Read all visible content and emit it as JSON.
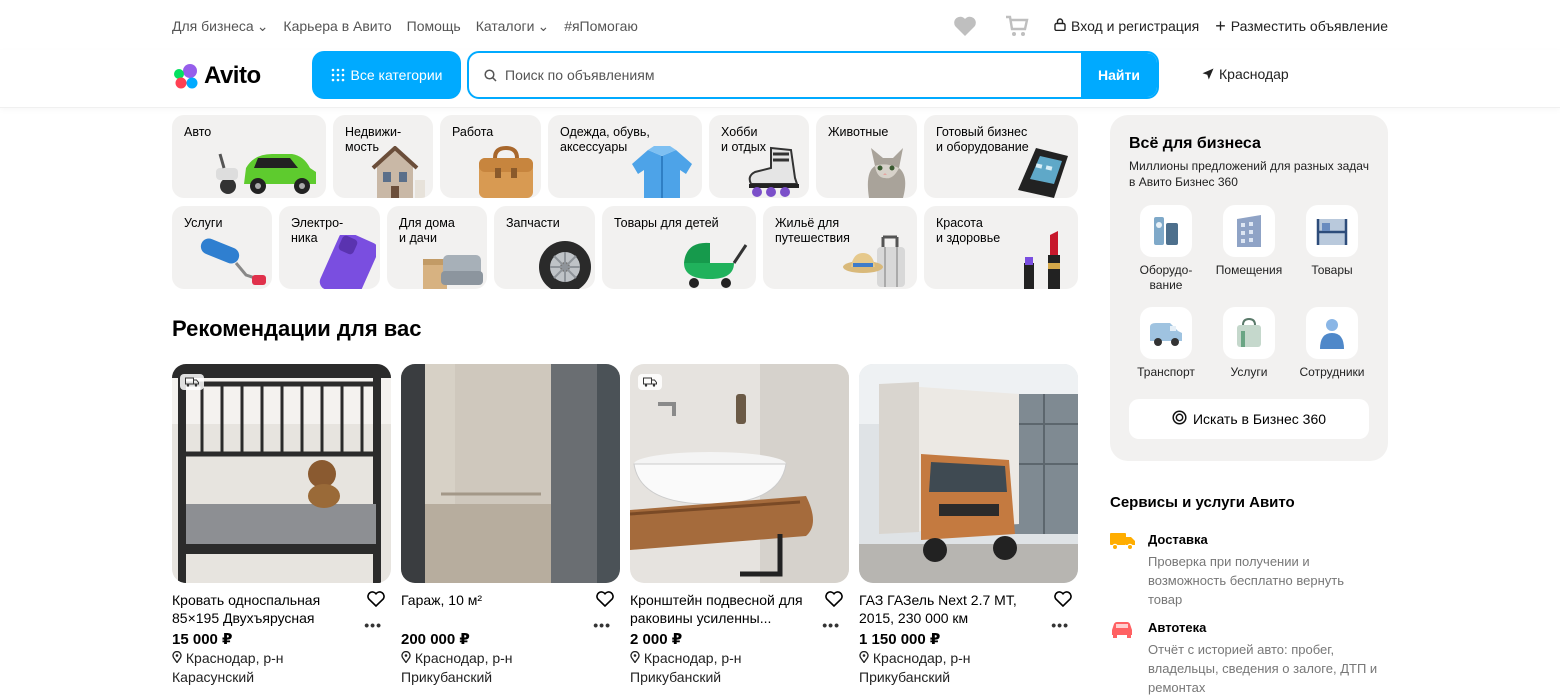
{
  "topnav": {
    "items": [
      "Для бизнеса",
      "Карьера в Авито",
      "Помощь",
      "Каталоги",
      "#яПомогаю"
    ],
    "login": "Вход и регистрация",
    "post_ad": "Разместить объявление"
  },
  "header": {
    "logo": "Avito",
    "all_categories": "Все категории",
    "search_placeholder": "Поиск по объявлениям",
    "search_button": "Найти",
    "city": "Краснодар"
  },
  "categories": [
    {
      "label": "Авто"
    },
    {
      "label": "Недвижи-\nмость"
    },
    {
      "label": "Работа"
    },
    {
      "label": "Одежда, обувь,\nаксессуары"
    },
    {
      "label": "Хобби\nи отдых"
    },
    {
      "label": "Животные"
    },
    {
      "label": "Готовый бизнес\nи оборудование"
    },
    {
      "label": "Услуги"
    },
    {
      "label": "Электро-\nника"
    },
    {
      "label": "Для дома\nи дачи"
    },
    {
      "label": "Запчасти"
    },
    {
      "label": "Товары для детей"
    },
    {
      "label": "Жильё для\nпутешествия"
    },
    {
      "label": "Красота\nи здоровье"
    }
  ],
  "recommendations": {
    "title": "Рекомендации для вас",
    "items": [
      {
        "title": "Кровать односпальная 85×195 Двухъярусная",
        "price": "15 000 ₽",
        "location": "Краснодар, р-н Карасунский"
      },
      {
        "title": "Гараж, 10 м²",
        "price": "200 000 ₽",
        "location": "Краснодар, р-н Прикубанский"
      },
      {
        "title": "Кронштейн подвесной для раковины усиленны...",
        "price": "2 000 ₽",
        "location": "Краснодар, р-н Прикубанский"
      },
      {
        "title": "ГАЗ ГАЗель Next 2.7 MT, 2015, 230 000 км",
        "price": "1 150 000 ₽",
        "location": "Краснодар, р-н Прикубанский"
      }
    ]
  },
  "business": {
    "title": "Всё для бизнеса",
    "subtitle": "Миллионы предложений для разных задач в Авито Бизнес 360",
    "tiles": [
      "Оборудо-\nвание",
      "Помещения",
      "Товары",
      "Транспорт",
      "Услуги",
      "Сотрудники"
    ],
    "button": "Искать в Бизнес 360"
  },
  "services": {
    "title": "Сервисы и услуги Авито",
    "items": [
      {
        "name": "Доставка",
        "desc": "Проверка при получении и возможность бесплатно вернуть товар"
      },
      {
        "name": "Автотека",
        "desc": "Отчёт с историей авто: пробег, владельцы, сведения о залоге, ДТП и ремонтах"
      }
    ]
  },
  "colors": {
    "accent": "#00aaff",
    "delivery_icon": "#ffad00",
    "autoteka_icon": "#ff6163"
  }
}
